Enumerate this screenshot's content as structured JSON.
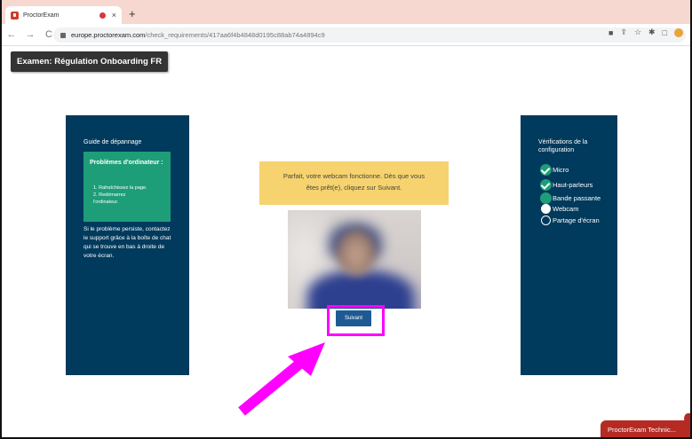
{
  "browser": {
    "tab_title": "ProctorExam",
    "tab_close": "×",
    "new_tab": "+",
    "url_host": "europe.proctorexam.com",
    "url_path": "/check_requirements/417aa6f4b4848d0195c88ab74a4894c9"
  },
  "exam": {
    "title": "Examen: Régulation Onboarding FR"
  },
  "guide": {
    "title": "Guide de dépannage",
    "box_title": "Problèmes d'ordinateur :",
    "steps": [
      "1. Rafraîchissez la page.",
      "2. Redémarrez",
      "l'ordinateur."
    ],
    "help_text": "Si le problème persiste, contactez le support grâce à la boîte de chat qui se trouve en bas à droite de votre écran."
  },
  "notice": {
    "line1": "Parfait, votre webcam fonctionne. Dès que vous",
    "line2": "êtes prêt(e), cliquez sur Suivant."
  },
  "next_button": "Suivant",
  "checks": {
    "title": "Vérifications de la configuration",
    "items": [
      {
        "label": "Micro",
        "status": "done"
      },
      {
        "label": "Haut-parleurs",
        "status": "done"
      },
      {
        "label": "Bande passante",
        "status": "pending"
      },
      {
        "label": "Webcam",
        "status": "current"
      },
      {
        "label": "Partage d'écran",
        "status": "empty"
      }
    ]
  },
  "chat": {
    "label": "ProctorExam Technic..."
  },
  "colors": {
    "panel": "#003a5c",
    "success": "#1e9e78",
    "notice": "#f6d36e",
    "button": "#1d5a94",
    "highlight": "#ff00ff",
    "chat": "#b52b24"
  }
}
